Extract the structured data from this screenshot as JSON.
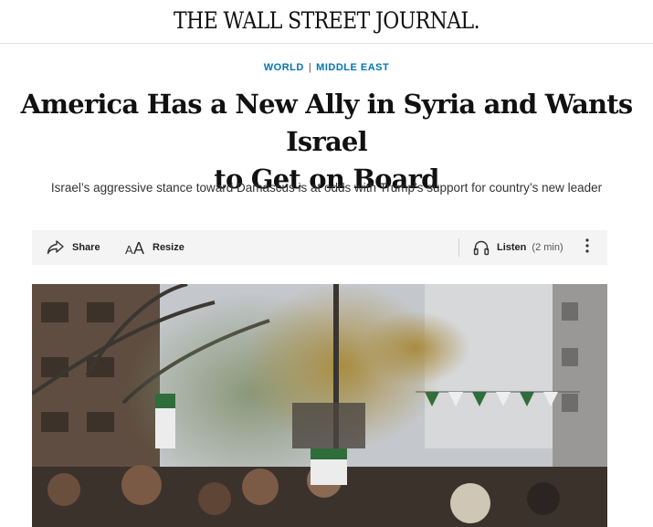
{
  "masthead": {
    "title": "THE WALL STREET JOURNAL."
  },
  "kicker": {
    "section": "WORLD",
    "subsection": "MIDDLE EAST",
    "separator": "|"
  },
  "article": {
    "headline_line1": "America Has a New Ally in Syria and Wants Israel",
    "headline_line2": "to Get on Board",
    "dek": "Israel’s aggressive stance toward Damascus is at odds with Trump’s support for country’s new leader"
  },
  "toolbar": {
    "share_label": "Share",
    "resize_label": "Resize",
    "listen_label": "Listen",
    "listen_duration": "(2 min)",
    "icons": [
      "share-icon",
      "resize-icon",
      "headphones-icon",
      "more-options-icon"
    ]
  },
  "photo": {
    "icon": "photo"
  },
  "colors": {
    "kicker": "#0274b6",
    "toolbar_bg": "#f4f4f4",
    "text": "#111111"
  }
}
